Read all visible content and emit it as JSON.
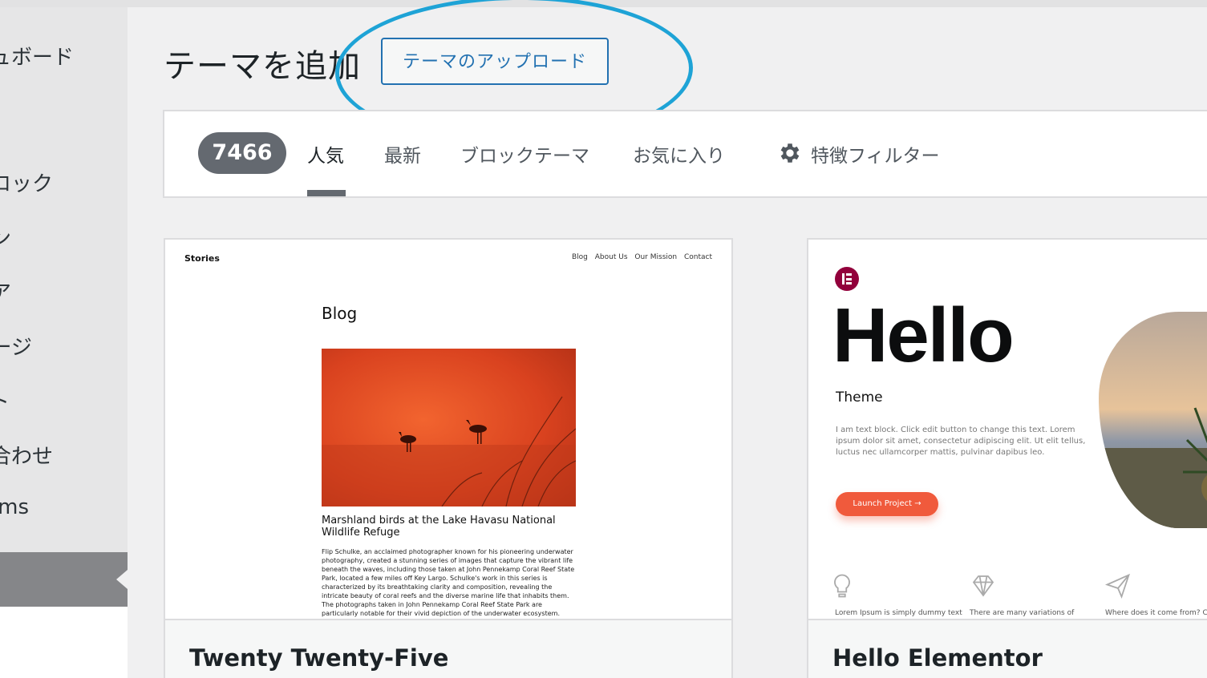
{
  "sidebar": {
    "items": [
      {
        "label": "ュボード"
      },
      {
        "label": "ロック"
      },
      {
        "label": "ン"
      },
      {
        "label": "ア"
      },
      {
        "label": "ージ"
      },
      {
        "label": "ト"
      },
      {
        "label": "合わせ"
      },
      {
        "label": "ms"
      }
    ]
  },
  "header": {
    "title": "テーマを追加",
    "upload_label": "テーマのアップロード"
  },
  "filter": {
    "count": "7466",
    "tabs": [
      {
        "label": "人気",
        "active": true
      },
      {
        "label": "最新",
        "active": false
      },
      {
        "label": "ブロックテーマ",
        "active": false
      },
      {
        "label": "お気に入り",
        "active": false
      }
    ],
    "feature_filter_label": "特徴フィルター"
  },
  "themes": [
    {
      "name": "Twenty Twenty-Five",
      "preview": {
        "site_name": "Stories",
        "nav": [
          "Blog",
          "About Us",
          "Our Mission",
          "Contact"
        ],
        "heading": "Blog",
        "post_title": "Marshland birds at the Lake Havasu National Wildlife Refuge",
        "post_body": "Flip Schulke, an acclaimed photographer known for his pioneering underwater photography, created a stunning series of images that capture the vibrant life beneath the waves, including those taken at John Pennekamp Coral Reef State Park, located a few miles off Key Largo. Schulke's work in this series is characterized by its breathtaking clarity and composition, revealing the intricate beauty of coral reefs and the diverse marine life that inhabits them. The photographs taken in John Pennekamp Coral Reef State Park are particularly notable for their vivid depiction of the underwater ecosystem."
      }
    },
    {
      "name": "Hello Elementor",
      "preview": {
        "headline": "Hello",
        "subheadline": "Theme",
        "text": "I am text block. Click edit button to change this text. Lorem ipsum dolor sit amet, consectetur adipiscing elit. Ut elit tellus, luctus nec ullamcorper mattis, pulvinar dapibus leo.",
        "button": "Launch Project →",
        "features": [
          {
            "icon": "lightbulb-icon",
            "text": "Lorem Ipsum is simply dummy text"
          },
          {
            "icon": "diamond-icon",
            "text": "There are many variations of"
          },
          {
            "icon": "paper-plane-icon",
            "text": "Where does it come from? Cor"
          }
        ]
      }
    }
  ],
  "colors": {
    "accent": "#2271b1",
    "highlight_circle": "#1ea3d6",
    "count_badge": "#646970",
    "elementor": "#92003b",
    "launch_button": "#f05a3c"
  }
}
